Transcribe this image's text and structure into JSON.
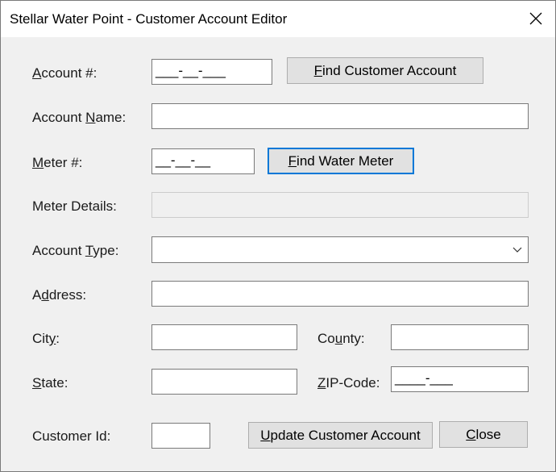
{
  "window": {
    "title": "Stellar Water Point - Customer Account Editor"
  },
  "labels": {
    "account_number": [
      "A",
      "ccount #:"
    ],
    "account_name": [
      "Account ",
      "N",
      "ame:"
    ],
    "meter_number": [
      "M",
      "eter #:"
    ],
    "meter_details": "Meter Details:",
    "account_type": [
      "Account ",
      "T",
      "ype:"
    ],
    "address": [
      "A",
      "d",
      "dress:"
    ],
    "city": [
      "Cit",
      "y",
      ":"
    ],
    "county": [
      "Co",
      "u",
      "nty:"
    ],
    "state": [
      "S",
      "tate:"
    ],
    "zip_code": [
      "Z",
      "IP-Code:"
    ],
    "customer_id": "Customer Id:"
  },
  "fields": {
    "account_number": "___-__-___",
    "account_name": "",
    "meter_number": "__-__-__",
    "meter_details": "",
    "account_type": "",
    "address": "",
    "city": "",
    "county": "",
    "state": "",
    "zip_code": "____-___",
    "customer_id": ""
  },
  "buttons": {
    "find_customer_account": [
      "F",
      "ind Customer Account"
    ],
    "find_water_meter": [
      "F",
      "ind Water Meter"
    ],
    "update_customer_account": [
      "U",
      "pdate Customer Account"
    ],
    "close": [
      "C",
      "lose"
    ]
  },
  "icons": {
    "close": "close-x-icon",
    "dropdown": "chevron-down-icon"
  },
  "colors": {
    "window_bg": "#f0f0f0",
    "focus_border": "#0078d7",
    "button_bg": "#e1e1e1"
  }
}
